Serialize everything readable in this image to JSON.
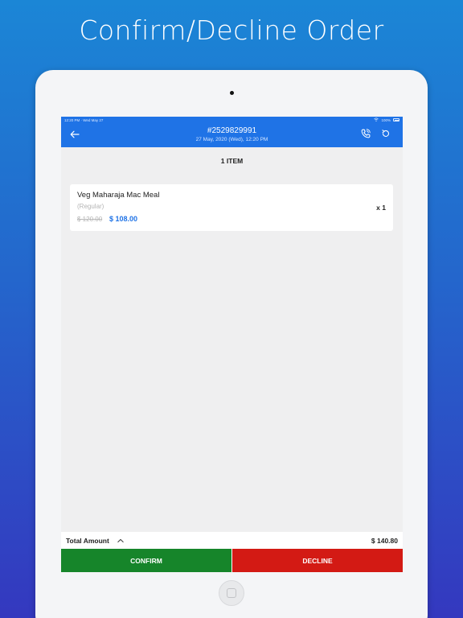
{
  "headline": "Confirm/Decline Order",
  "status_bar": {
    "time_date": "12:20 PM · Wed May 27",
    "battery": "100%"
  },
  "navbar": {
    "order_number": "#2529829991",
    "order_datetime": "27 May, 2020 (Wed),  12:20 PM",
    "back_icon": "arrow-left-icon",
    "call_icon": "phone-icon",
    "refresh_icon": "refresh-icon"
  },
  "items_count": "1 ITEM",
  "items": [
    {
      "name": "Veg Maharaja Mac Meal",
      "variant": "(Regular)",
      "original_price": "$ 120.00",
      "price": "$ 108.00",
      "quantity": "x 1"
    }
  ],
  "total": {
    "label": "Total Amount",
    "value": "$ 140.80"
  },
  "actions": {
    "confirm_label": "CONFIRM",
    "decline_label": "DECLINE"
  },
  "colors": {
    "primary": "#1f73e6",
    "confirm": "#16852a",
    "decline": "#d31a14"
  }
}
